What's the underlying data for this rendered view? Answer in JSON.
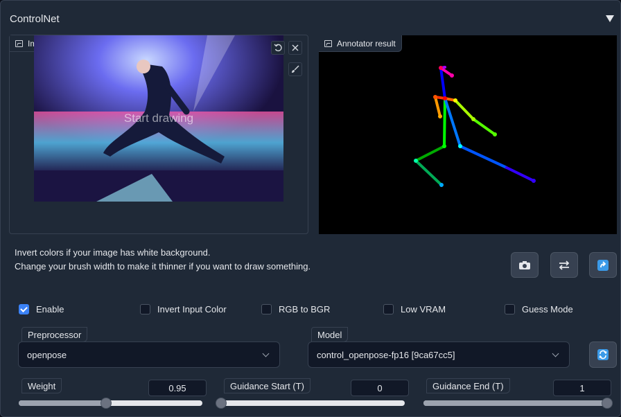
{
  "header": {
    "title": "ControlNet"
  },
  "image_input": {
    "label": "Image",
    "placeholder": "Start drawing",
    "undo_icon": "undo-icon",
    "clear_icon": "close-icon",
    "brush_icon": "brush-icon"
  },
  "annotator": {
    "label": "Annotator result"
  },
  "hints": {
    "line1": "Invert colors if your image has white background.",
    "line2": "Change your brush width to make it thinner if you want to draw something."
  },
  "actions": {
    "camera_icon": "camera-icon",
    "swap_icon": "swap-icon",
    "send_icon": "send-icon",
    "refresh_icon": "refresh-icon"
  },
  "checkboxes": [
    {
      "label": "Enable",
      "checked": true
    },
    {
      "label": "Invert Input Color",
      "checked": false
    },
    {
      "label": "RGB to BGR",
      "checked": false
    },
    {
      "label": "Low VRAM",
      "checked": false
    },
    {
      "label": "Guess Mode",
      "checked": false
    }
  ],
  "preprocessor": {
    "label": "Preprocessor",
    "value": "openpose"
  },
  "model": {
    "label": "Model",
    "value": "control_openpose-fp16 [9ca67cc5]"
  },
  "sliders": [
    {
      "label": "Weight",
      "value": "0.95",
      "fraction": 0.475
    },
    {
      "label": "Guidance Start (T)",
      "value": "0",
      "fraction": 0.0
    },
    {
      "label": "Guidance End (T)",
      "value": "1",
      "fraction": 1.0
    }
  ],
  "colors": {
    "accent": "#3b82f6",
    "panel": "#1f2937",
    "border": "#374151"
  }
}
